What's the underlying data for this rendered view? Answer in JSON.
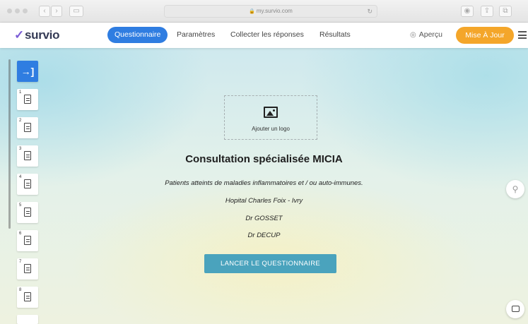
{
  "browser": {
    "url": "my.survio.com",
    "nav_back": "‹",
    "nav_forward": "›",
    "reload_glyph": "↻"
  },
  "app": {
    "logo_mark": "✓",
    "logo_text": "survio",
    "tabs": [
      {
        "label": "Questionnaire",
        "active": true
      },
      {
        "label": "Paramètres",
        "active": false
      },
      {
        "label": "Collecter les réponses",
        "active": false
      },
      {
        "label": "Résultats",
        "active": false
      }
    ],
    "preview_label": "Aperçu",
    "update_label": "Mise À Jour"
  },
  "sidebar": {
    "entry_glyph": "→]",
    "pages": [
      "1",
      "2",
      "3",
      "4",
      "5",
      "6",
      "7",
      "8"
    ]
  },
  "survey": {
    "logo_placeholder": "Ajouter un logo",
    "title": "Consultation spécialisée MICIA",
    "lines": [
      "Patients atteints de maladies inflammatoires et / ou auto-immunes.",
      "Hopital Charles Foix - Ivry",
      "Dr GOSSET",
      "Dr DECUP"
    ],
    "start_button": "LANCER LE QUESTIONNAIRE"
  },
  "colors": {
    "primary": "#2f7de1",
    "update": "#f4a62a",
    "start": "#4aa3bd",
    "logo_mark": "#7b5cd6"
  }
}
